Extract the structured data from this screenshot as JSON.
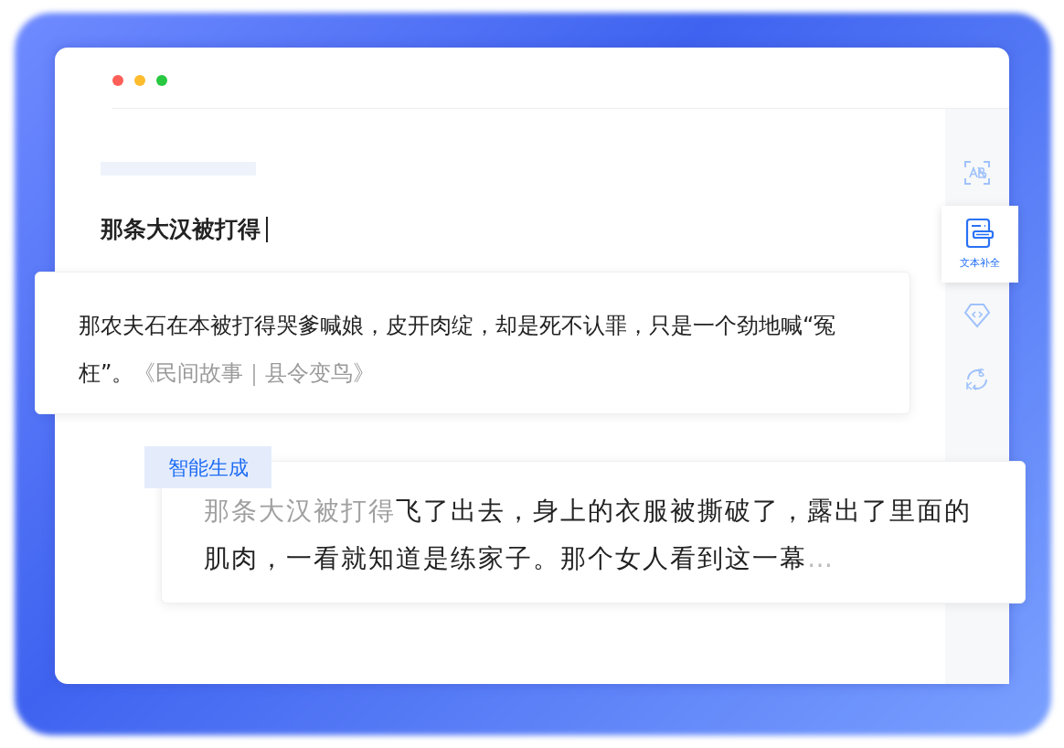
{
  "window_controls": [
    {
      "color": "#ff5f57"
    },
    {
      "color": "#febc2e"
    },
    {
      "color": "#28c840"
    }
  ],
  "editor": {
    "input": "那条大汉被打得"
  },
  "reference_card": {
    "text": "那农夫石在本被打得哭爹喊娘，皮开肉绽，却是死不认罪，只是一个劲地喊“冤枉”。",
    "source": "《民间故事｜县令变鸟》"
  },
  "generated_card": {
    "tag": "智能生成",
    "prompt": "那条大汉被打得",
    "continuation": "飞了出去，身上的衣服被撕破了，露出了里面的肌肉，一看就知道是练家子。那个女人看到这一幕",
    "ellipsis": "…"
  },
  "tools": [
    {
      "kind": "text-recognition",
      "selected": false
    },
    {
      "kind": "text-completion",
      "label": "文本补全",
      "selected": true
    },
    {
      "kind": "code",
      "selected": false
    },
    {
      "kind": "convert",
      "selected": false
    }
  ]
}
